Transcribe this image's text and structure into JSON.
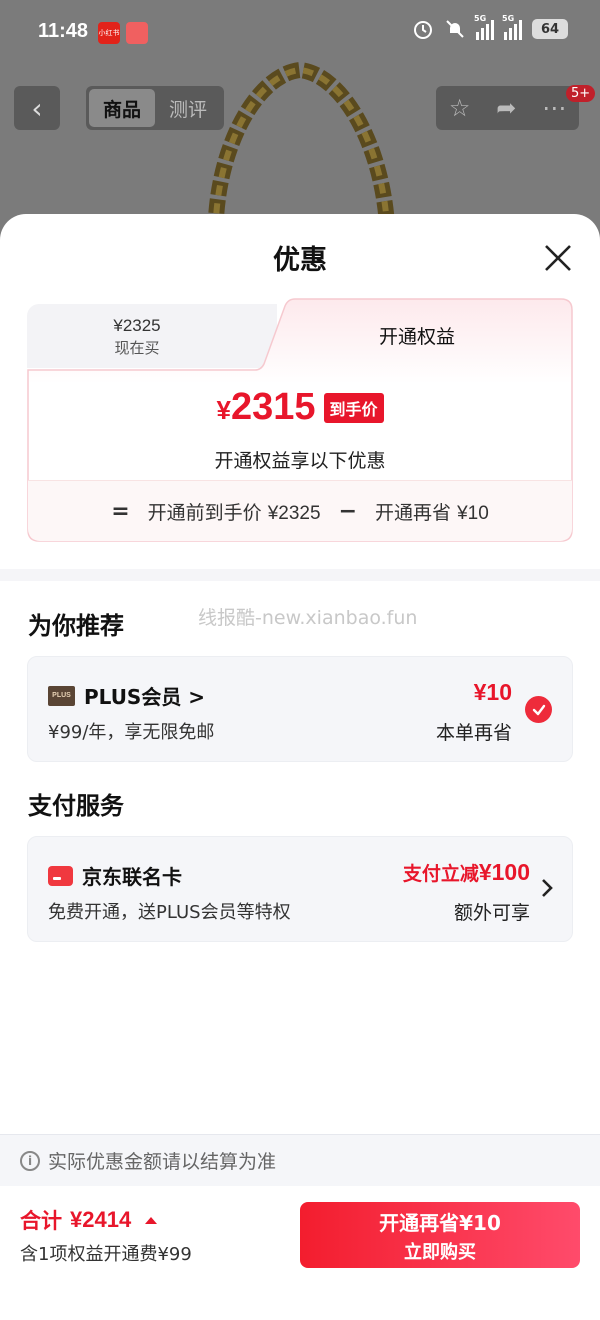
{
  "status_bar": {
    "time": "11:48",
    "app_badge_1": "小红书",
    "signal_1_tag": "5G",
    "signal_2_tag": "5G",
    "battery": "64"
  },
  "product_nav": {
    "tabs": [
      {
        "label": "商品",
        "active": true
      },
      {
        "label": "测评",
        "active": false
      }
    ],
    "message_badge": "5+"
  },
  "sheet": {
    "title": "优惠",
    "tab_left": {
      "price": "¥2325",
      "label": "现在买"
    },
    "tab_right": {
      "label": "开通权益"
    },
    "final_price_symbol": "¥",
    "final_price": "2315",
    "final_price_tag": "到手价",
    "final_price_desc": "开通权益享以下优惠",
    "formula": {
      "eq": "=",
      "before_label": "开通前到手价",
      "before_value": "¥2325",
      "minus": "−",
      "save_label": "开通再省",
      "save_value": "¥10"
    }
  },
  "recommend": {
    "title": "为你推荐",
    "watermark": "线报酷-new.xianbao.fun",
    "plus_card": {
      "logo_text": "PLUS",
      "title": "PLUS会员 >",
      "subtitle": "¥99/年，享无限免邮",
      "amount": "¥10",
      "amount_label": "本单再省",
      "checked": true
    }
  },
  "payment": {
    "title": "支付服务",
    "card": {
      "title": "京东联名卡",
      "subtitle": "免费开通，送PLUS会员等特权",
      "amount_prefix": "支付立减",
      "amount": "¥100",
      "amount_label": "额外可享"
    }
  },
  "footer": {
    "notice": "实际优惠金额请以结算为准",
    "total_label": "合计",
    "total_value": "¥2414",
    "total_sub": "含1项权益开通费¥99",
    "buy_line1": "开通再省¥10",
    "buy_line2": "立即购买"
  },
  "colors": {
    "accent_red": "#e8162b",
    "plus_brown": "#5a4535"
  }
}
